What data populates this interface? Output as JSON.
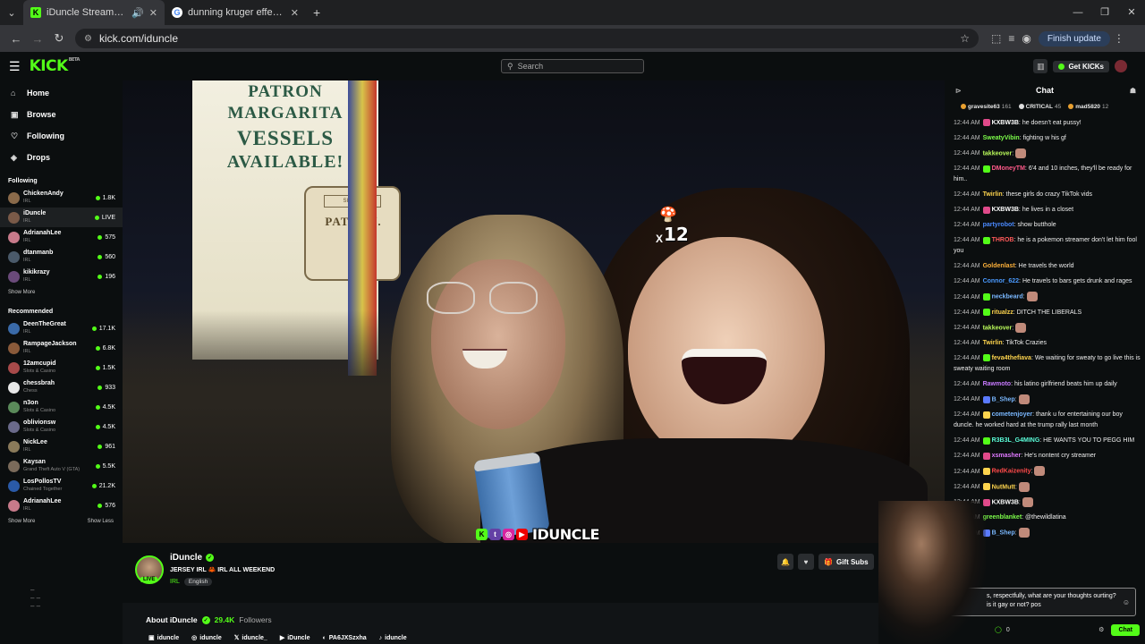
{
  "browser": {
    "tabs": [
      {
        "title": "iDuncle Stream - Watch Live",
        "active": true
      },
      {
        "title": "dunning kruger effect - Google",
        "active": false
      }
    ],
    "url": "kick.com/iduncle",
    "finish_update": "Finish update"
  },
  "header": {
    "logo": "KICK",
    "beta": "BETA",
    "search_placeholder": "Search",
    "get_kicks": "Get KICKs"
  },
  "sidebar": {
    "nav": [
      {
        "label": "Home",
        "icon": "home-icon"
      },
      {
        "label": "Browse",
        "icon": "browse-icon"
      },
      {
        "label": "Following",
        "icon": "heart-icon"
      },
      {
        "label": "Drops",
        "icon": "drops-icon"
      }
    ],
    "following_title": "Following",
    "following": [
      {
        "name": "ChickenAndy",
        "cat": "IRL",
        "viewers": "1.8K",
        "color": "#8a6a4a"
      },
      {
        "name": "iDuncle",
        "cat": "IRL",
        "viewers": "LIVE",
        "color": "#7a5a48"
      },
      {
        "name": "AdrianahLee",
        "cat": "IRL",
        "viewers": "575",
        "color": "#c77a8a"
      },
      {
        "name": "dtanmanb",
        "cat": "IRL",
        "viewers": "560",
        "color": "#4a5a6a"
      },
      {
        "name": "kikikrazy",
        "cat": "IRL",
        "viewers": "196",
        "color": "#6a4a7a"
      }
    ],
    "show_more": "Show More",
    "recommended_title": "Recommended",
    "recommended": [
      {
        "name": "DeenTheGreat",
        "cat": "IRL",
        "viewers": "17.1K",
        "color": "#3a6aa8"
      },
      {
        "name": "RampageJackson",
        "cat": "IRL",
        "viewers": "6.8K",
        "color": "#8a5a3a"
      },
      {
        "name": "12amcupid",
        "cat": "Slots & Casino",
        "viewers": "1.5K",
        "color": "#a84a4a"
      },
      {
        "name": "chessbrah",
        "cat": "Chess",
        "viewers": "933",
        "color": "#e8e8e8"
      },
      {
        "name": "n3on",
        "cat": "Slots & Casino",
        "viewers": "4.5K",
        "color": "#5a8a5a"
      },
      {
        "name": "oblivionsw",
        "cat": "Slots & Casino",
        "viewers": "4.5K",
        "color": "#6a6a8a"
      },
      {
        "name": "NickLee",
        "cat": "IRL",
        "viewers": "961",
        "color": "#8a7a5a"
      },
      {
        "name": "Kaysan",
        "cat": "Grand Theft Auto V (GTA)",
        "viewers": "5.5K",
        "color": "#7a6a5a"
      },
      {
        "name": "LosPollosTV",
        "cat": "Chained Together",
        "viewers": "21.2K",
        "color": "#2a5aa8"
      },
      {
        "name": "AdrianahLee",
        "cat": "IRL",
        "viewers": "576",
        "color": "#c77a8a"
      }
    ],
    "show_less": "Show Less"
  },
  "video": {
    "sign_lines": [
      "PATRON",
      "MARGARITA",
      "VESSELS",
      "AVAILABLE!"
    ],
    "bottle_label": "PATRON.",
    "bottle_top": "SILVER",
    "overlay_text": "IDUNCLE",
    "combo_x": "X",
    "combo_count": "12"
  },
  "streamer": {
    "name": "iDuncle",
    "title": "JERSEY IRL 🦀 IRL ALL WEEKEND",
    "category": "IRL",
    "language": "English",
    "live": "LIVE",
    "gift_subs": "Gift Subs",
    "about": "About iDuncle",
    "followers_count": "29.4K",
    "followers_label": "Followers",
    "socials": [
      "iduncle",
      "iduncle",
      "iduncle_",
      "iDuncle",
      "PA6JXSzxha",
      "iduncle"
    ]
  },
  "chat": {
    "title": "Chat",
    "pinned": [
      {
        "name": "gravesite63",
        "count": "161",
        "color": "#e8a030"
      },
      {
        "name": "CRITICAL",
        "count": "45",
        "color": "#dddddd"
      },
      {
        "name": "mad5820",
        "count": "12",
        "color": "#e8a030"
      }
    ],
    "messages": [
      {
        "time": "12:44 AM",
        "user": "KXBW3B",
        "ucolor": "#ffffff",
        "text": "he doesn't eat pussy!",
        "badge": "#e04a8a"
      },
      {
        "time": "12:44 AM",
        "user": "SweatyVibin",
        "ucolor": "#7cfc4a",
        "text": "fighting w his gf",
        "badge": ""
      },
      {
        "time": "12:44 AM",
        "user": "takkeover",
        "ucolor": "#b9f95a",
        "text": "",
        "badge": "",
        "emote": true
      },
      {
        "time": "12:44 AM",
        "user": "DMoneyTM",
        "ucolor": "#ff5a8a",
        "text": "6'4 and 10 inches, they'll be ready for him..",
        "badge": "#53fc18"
      },
      {
        "time": "12:44 AM",
        "user": "Twirlin",
        "ucolor": "#fcd34d",
        "text": "these girls do crazy TikTok vids",
        "badge": ""
      },
      {
        "time": "12:44 AM",
        "user": "KXBW3B",
        "ucolor": "#ffffff",
        "text": "he lives in a closet",
        "badge": "#e04a8a"
      },
      {
        "time": "12:44 AM",
        "user": "partyrobot",
        "ucolor": "#4a8aff",
        "text": "show butthole",
        "badge": ""
      },
      {
        "time": "12:44 AM",
        "user": "THROB",
        "ucolor": "#ff5a5a",
        "text": "he is a pokemon streamer don't let him fool you",
        "badge": "#53fc18"
      },
      {
        "time": "12:44 AM",
        "user": "Goldenlast",
        "ucolor": "#fcb03a",
        "text": "He travels the world",
        "badge": ""
      },
      {
        "time": "12:44 AM",
        "user": "Connor_622",
        "ucolor": "#4a9aff",
        "text": "He travels to bars gets drunk and rages",
        "badge": ""
      },
      {
        "time": "12:44 AM",
        "user": "neckbeard",
        "ucolor": "#7ab8ff",
        "text": "",
        "badge": "#53fc18",
        "emote": true
      },
      {
        "time": "12:44 AM",
        "user": "ritualzz",
        "ucolor": "#fcd34d",
        "text": "DITCH THE LIBERALS",
        "badge": "#53fc18"
      },
      {
        "time": "12:44 AM",
        "user": "takkeover",
        "ucolor": "#b9f95a",
        "text": "",
        "badge": "",
        "emote": true
      },
      {
        "time": "12:44 AM",
        "user": "Twirlin",
        "ucolor": "#fcd34d",
        "text": "TikTok Crazies",
        "badge": ""
      },
      {
        "time": "12:44 AM",
        "user": "feva4thefiava",
        "ucolor": "#fcd34d",
        "text": "We waiting for sweaty to go live this is sweaty waiting room",
        "badge": "#53fc18"
      },
      {
        "time": "12:44 AM",
        "user": "Rawmoto",
        "ucolor": "#c77aff",
        "text": "his latino girlfriend beats him up daily",
        "badge": ""
      },
      {
        "time": "12:44 AM",
        "user": "B_Shep",
        "ucolor": "#7ab8ff",
        "text": "",
        "badge": "#5a7aff",
        "emote": true
      },
      {
        "time": "12:44 AM",
        "user": "cometenjoyer",
        "ucolor": "#7ab8ff",
        "text": "thank u for entertaining our boy duncle. he worked hard at the trump rally last month",
        "badge": "#fcd34d"
      },
      {
        "time": "12:44 AM",
        "user": "R3B3L_G4MING",
        "ucolor": "#5afcd8",
        "text": "HE WANTS YOU TO PEGG HIM",
        "badge": "#53fc18"
      },
      {
        "time": "12:44 AM",
        "user": "xsmasher",
        "ucolor": "#e07aff",
        "text": "He's nontent cry streamer",
        "badge": "#e04a8a"
      },
      {
        "time": "12:44 AM",
        "user": "RedKaizenity",
        "ucolor": "#ff4a4a",
        "text": "",
        "badge": "#fcd34d",
        "emote": true
      },
      {
        "time": "12:44 AM",
        "user": "NutMutt",
        "ucolor": "#fcd34d",
        "text": "",
        "badge": "#fcd34d",
        "emote": true
      },
      {
        "time": "12:44 AM",
        "user": "KXBW3B",
        "ucolor": "#ffffff",
        "text": "",
        "badge": "#e04a8a",
        "emote": true
      },
      {
        "time": "12:44 AM",
        "user": "greenblanket",
        "ucolor": "#7cfc4a",
        "text": "@thewildlatina",
        "badge": ""
      },
      {
        "time": "12:44 AM",
        "user": "B_Shep",
        "ucolor": "#7ab8ff",
        "text": "",
        "badge": "#5a7aff",
        "emote": true
      }
    ],
    "input_text": "s, respectfully, what are your thoughts ourting? is it gay or not? pos",
    "points": "0",
    "send": "Chat"
  }
}
